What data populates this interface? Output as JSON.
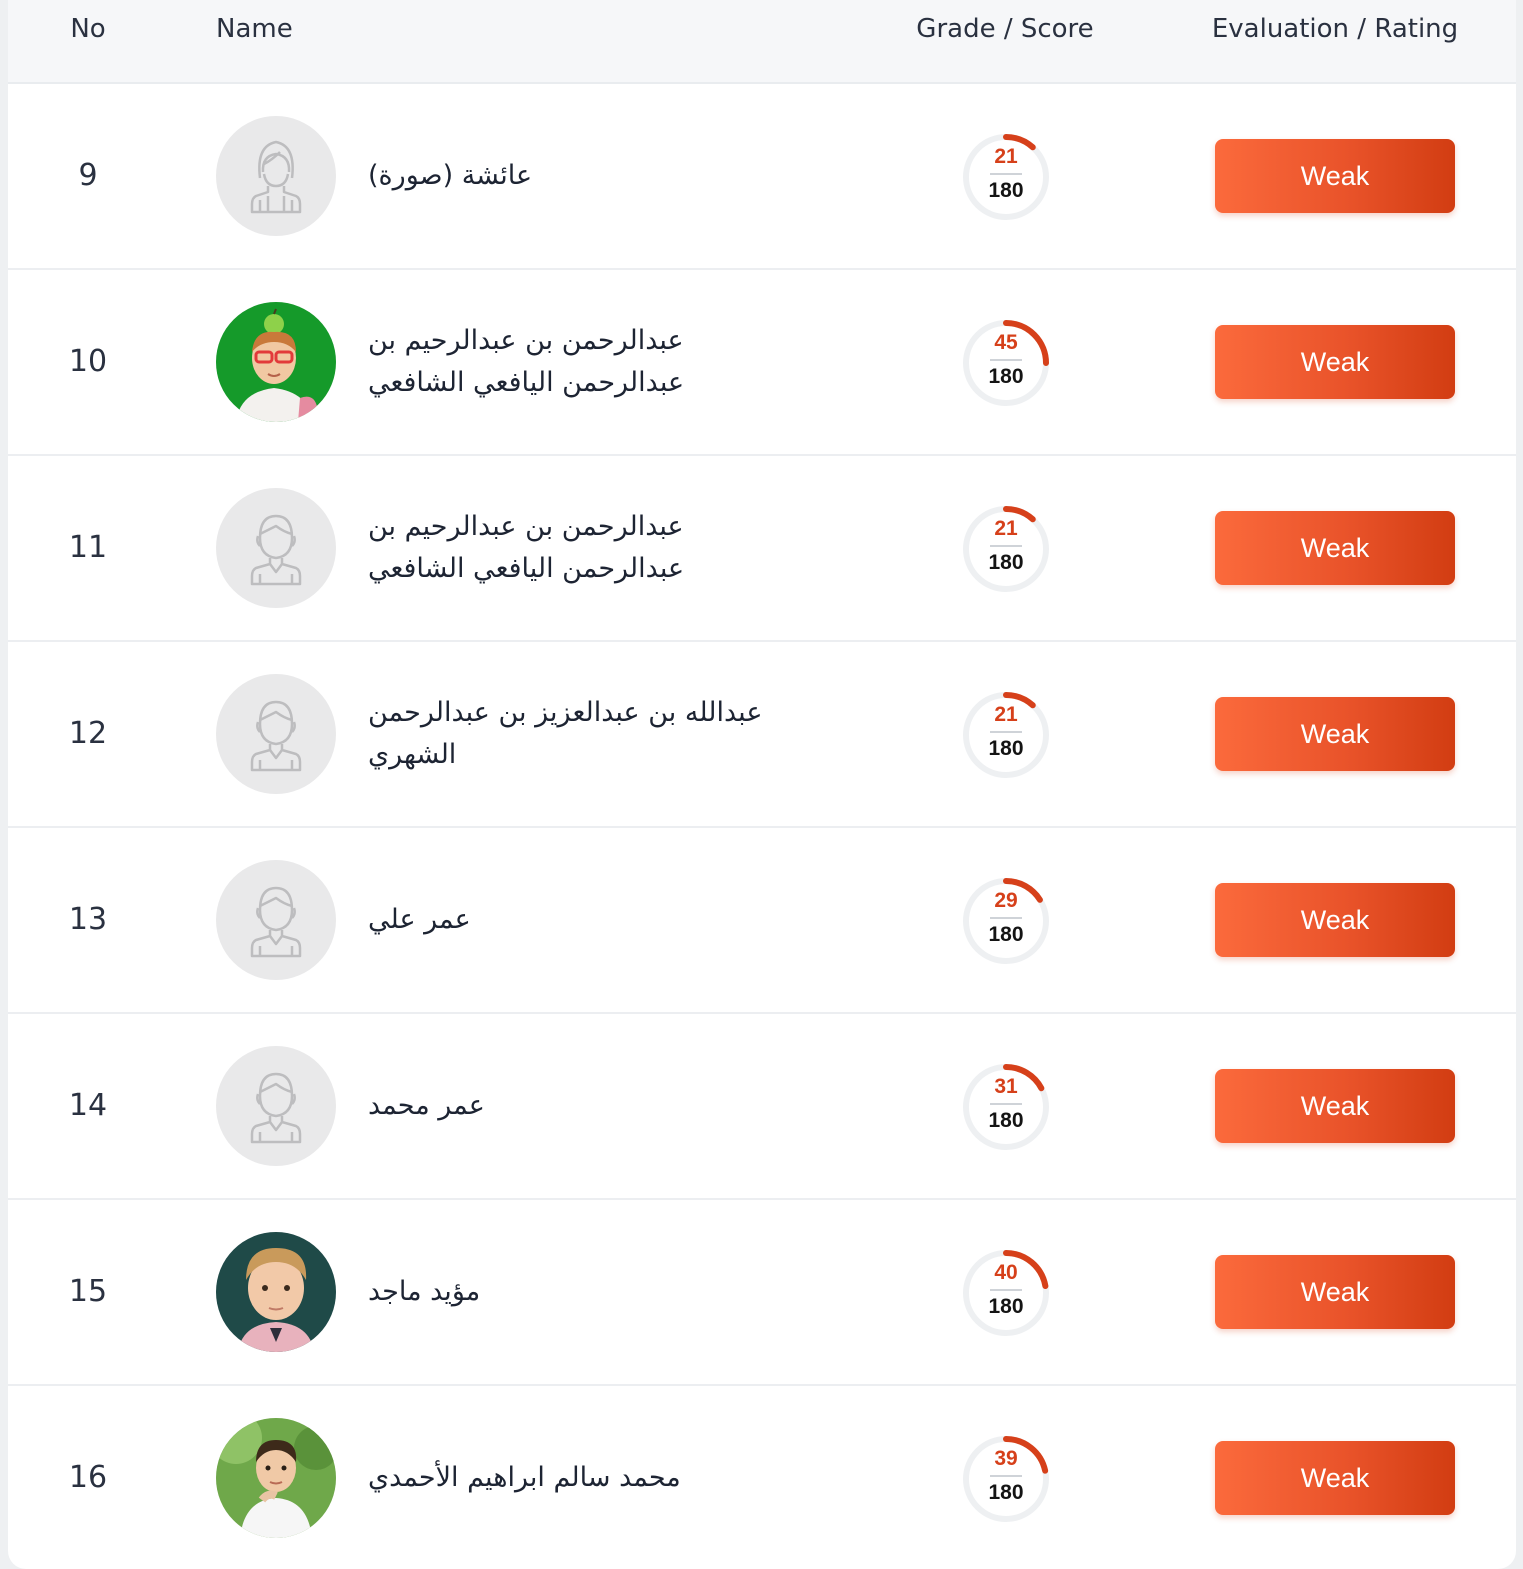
{
  "header": {
    "no": "No",
    "name": "Name",
    "score": "Grade / Score",
    "rating": "Evaluation / Rating"
  },
  "colors": {
    "accent": "#e9532a",
    "arc": "#d6401a",
    "ring_track": "#eef0f2"
  },
  "rows": [
    {
      "no": "9",
      "name": "عائشة (صورة)",
      "avatar": "female-placeholder-icon",
      "score": "21",
      "total": "180",
      "rating": "Weak"
    },
    {
      "no": "10",
      "name": "عبدالرحمن بن عبدالرحيم بن عبدالرحمن اليافعي الشافعي",
      "avatar": "student-photo-green",
      "score": "45",
      "total": "180",
      "rating": "Weak"
    },
    {
      "no": "11",
      "name": "عبدالرحمن بن عبدالرحيم بن عبدالرحمن اليافعي الشافعي",
      "avatar": "male-placeholder-icon",
      "score": "21",
      "total": "180",
      "rating": "Weak"
    },
    {
      "no": "12",
      "name": "عبدالله بن عبدالعزيز بن عبدالرحمن الشهري",
      "avatar": "male-placeholder-icon",
      "score": "21",
      "total": "180",
      "rating": "Weak"
    },
    {
      "no": "13",
      "name": "عمر علي",
      "avatar": "male-placeholder-icon",
      "score": "29",
      "total": "180",
      "rating": "Weak"
    },
    {
      "no": "14",
      "name": "عمر محمد",
      "avatar": "male-placeholder-icon",
      "score": "31",
      "total": "180",
      "rating": "Weak"
    },
    {
      "no": "15",
      "name": "مؤيد ماجد",
      "avatar": "student-photo-dark",
      "score": "40",
      "total": "180",
      "rating": "Weak"
    },
    {
      "no": "16",
      "name": "محمد سالم ابراهيم الأحمدي",
      "avatar": "student-photo-outdoor",
      "score": "39",
      "total": "180",
      "rating": "Weak"
    }
  ]
}
